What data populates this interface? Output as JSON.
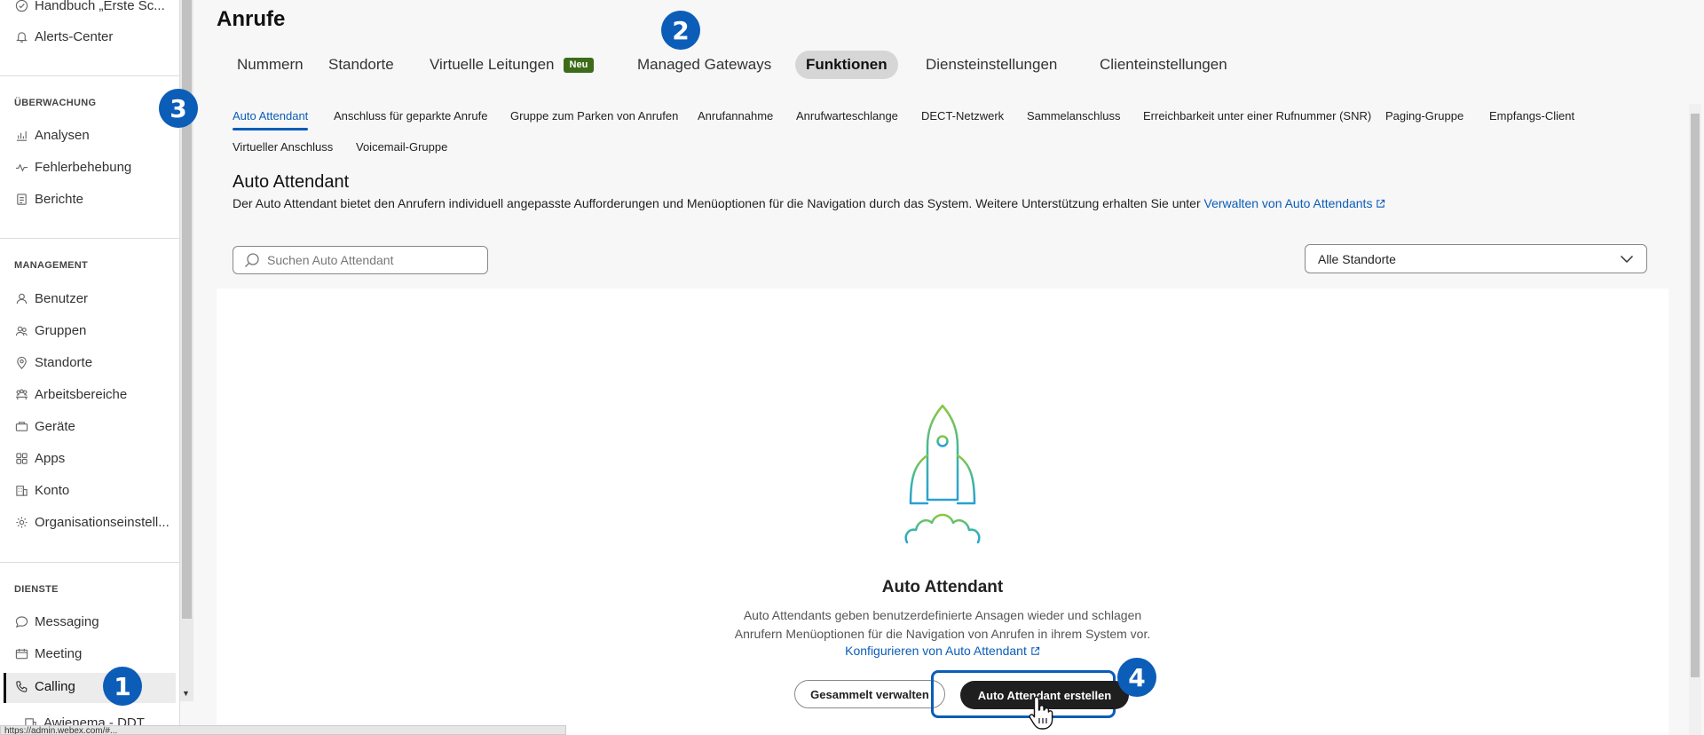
{
  "sidebar": {
    "top_items": [
      {
        "label": "Handbuch „Erste Sc...",
        "icon": "check-circle-icon"
      },
      {
        "label": "Alerts-Center",
        "icon": "bell-icon"
      }
    ],
    "sections": [
      {
        "heading": "ÜBERWACHUNG",
        "items": [
          {
            "label": "Analysen",
            "icon": "chart-icon"
          },
          {
            "label": "Fehlerbehebung",
            "icon": "pulse-icon"
          },
          {
            "label": "Berichte",
            "icon": "report-icon"
          }
        ]
      },
      {
        "heading": "MANAGEMENT",
        "items": [
          {
            "label": "Benutzer",
            "icon": "user-icon"
          },
          {
            "label": "Gruppen",
            "icon": "group-icon"
          },
          {
            "label": "Standorte",
            "icon": "location-icon"
          },
          {
            "label": "Arbeitsbereiche",
            "icon": "workspace-icon"
          },
          {
            "label": "Geräte",
            "icon": "device-icon"
          },
          {
            "label": "Apps",
            "icon": "apps-icon"
          },
          {
            "label": "Konto",
            "icon": "account-icon"
          },
          {
            "label": "Organisationseinstell...",
            "icon": "gear-icon"
          }
        ]
      },
      {
        "heading": "DIENSTE",
        "items": [
          {
            "label": "Messaging",
            "icon": "chat-icon"
          },
          {
            "label": "Meeting",
            "icon": "meeting-icon"
          },
          {
            "label": "Calling",
            "icon": "phone-icon"
          }
        ]
      }
    ],
    "bottom_item": {
      "label": "Awienema - DDT",
      "icon": "building-icon"
    }
  },
  "header": {
    "title": "Anrufe"
  },
  "tabs": [
    {
      "label": "Nummern"
    },
    {
      "label": "Standorte"
    },
    {
      "label": "Virtuelle Leitungen",
      "badge": "Neu"
    },
    {
      "label": "Managed Gateways"
    },
    {
      "label": "Funktionen",
      "active": true
    },
    {
      "label": "Diensteinstellungen"
    },
    {
      "label": "Clienteinstellungen"
    }
  ],
  "subtabs": [
    {
      "label": "Auto Attendant",
      "active": true
    },
    {
      "label": "Anschluss für geparkte Anrufe"
    },
    {
      "label": "Gruppe zum Parken von Anrufen"
    },
    {
      "label": "Anrufannahme"
    },
    {
      "label": "Anrufwarteschlange"
    },
    {
      "label": "DECT-Netzwerk"
    },
    {
      "label": "Sammelanschluss"
    },
    {
      "label": "Erreichbarkeit unter einer Rufnummer (SNR)"
    },
    {
      "label": "Paging-Gruppe"
    },
    {
      "label": "Empfangs-Client"
    },
    {
      "label": "Virtueller Anschluss"
    },
    {
      "label": "Voicemail-Gruppe"
    }
  ],
  "section": {
    "title": "Auto Attendant",
    "description": "Der Auto Attendant bietet den Anrufern individuell angepasste Aufforderungen und Menüoptionen für die Navigation durch das System. Weitere Unterstützung erhalten Sie unter ",
    "link": "Verwalten von Auto Attendants"
  },
  "search": {
    "placeholder": "Suchen Auto Attendant"
  },
  "location_select": {
    "value": "Alle Standorte"
  },
  "empty_state": {
    "title": "Auto Attendant",
    "line1": "Auto Attendants geben benutzerdefinierte Ansagen wieder und schlagen",
    "line2": "Anrufern Menüoptionen für die Navigation von Anrufen in ihrem System vor.",
    "link": "Konfigurieren von Auto Attendant",
    "secondary_button": "Gesammelt verwalten",
    "primary_button": "Auto Attendant erstellen"
  },
  "markers": [
    "1",
    "2",
    "3",
    "4"
  ],
  "status_bar": {
    "text": "https://admin.webex.com/#..."
  },
  "colors": {
    "accent": "#0b5db8",
    "badge": "#3c6b1a",
    "primary_button": "#1f1f1f"
  }
}
